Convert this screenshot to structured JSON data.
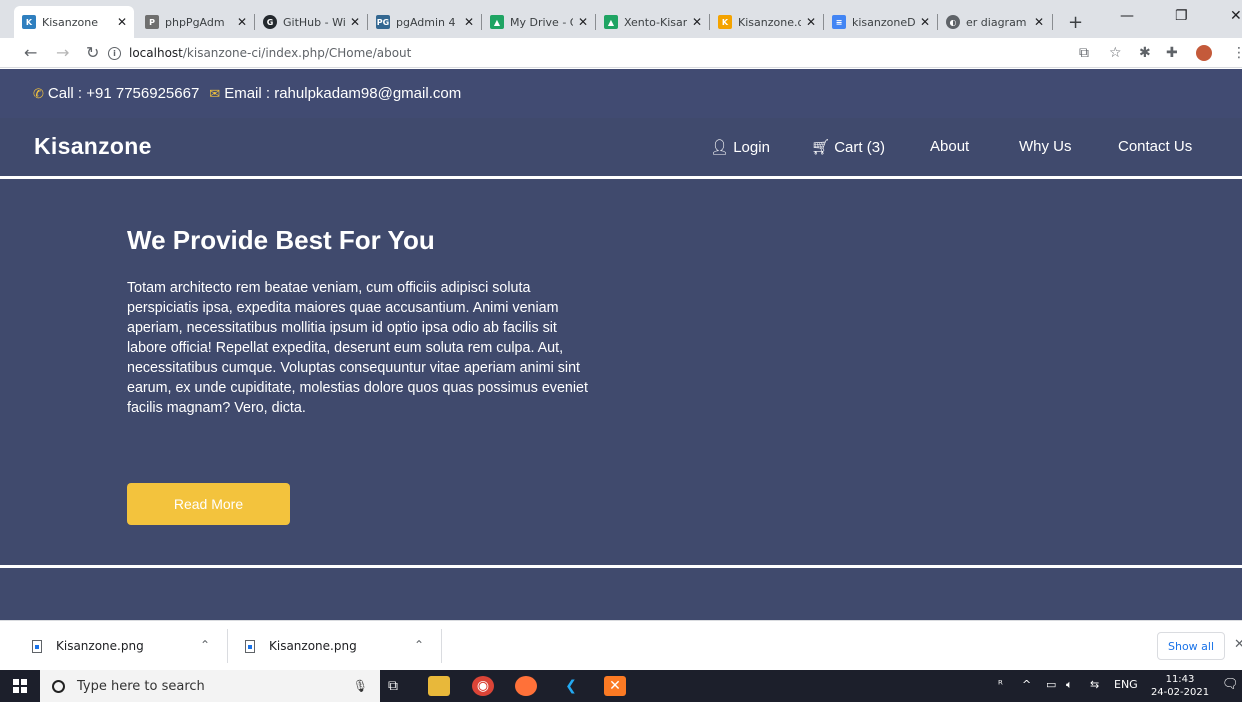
{
  "browser": {
    "tabs": [
      {
        "title": "Kisanzone",
        "color": "#2f7fbf",
        "glyph": "K",
        "active": true
      },
      {
        "title": "phpPgAdm",
        "color": "#6f6f6f",
        "glyph": "P",
        "active": false
      },
      {
        "title": "GitHub - Wi",
        "color": "#24292e",
        "glyph": "G",
        "active": false
      },
      {
        "title": "pgAdmin 4",
        "color": "#336791",
        "glyph": "PG",
        "active": false
      },
      {
        "title": "My Drive - G",
        "color": "#1fa463",
        "glyph": "▲",
        "active": false
      },
      {
        "title": "Xento-Kisan",
        "color": "#1fa463",
        "glyph": "▲",
        "active": false
      },
      {
        "title": "Kisanzone.d",
        "color": "#f4a300",
        "glyph": "K",
        "active": false
      },
      {
        "title": "kisanzoneDB",
        "color": "#4285f4",
        "glyph": "≡",
        "active": false
      },
      {
        "title": "er diagram",
        "color": "#5f6368",
        "glyph": "◐",
        "active": false
      }
    ],
    "url_host": "localhost",
    "url_path": "/kisanzone-ci/index.php/CHome/about"
  },
  "site": {
    "phone": "Call : +91 7756925667",
    "email": "Email : rahulpkadam98@gmail.com",
    "brand": "Kisanzone",
    "nav": {
      "login": "Login",
      "cart": "Cart (3)",
      "about": "About",
      "why_us": "Why Us",
      "contact": "Contact Us"
    },
    "hero": {
      "title": "We Provide Best For You",
      "text": "Totam architecto rem beatae veniam, cum officiis adipisci soluta perspiciatis ipsa, expedita maiores quae accusantium. Animi veniam aperiam, necessitatibus mollitia ipsum id optio ipsa odio ab facilis sit labore officia! Repellat expedita, deserunt eum soluta rem culpa. Aut, necessitatibus cumque. Voluptas consequuntur vitae aperiam animi sint earum, ex unde cupiditate, molestias dolore quos quas possimus eveniet facilis magnam? Vero, dicta.",
      "button": "Read More"
    },
    "colors": {
      "background": "#404a6d",
      "accent": "#f3c33d"
    }
  },
  "downloads": {
    "items": [
      "Kisanzone.png",
      "Kisanzone.png"
    ],
    "show_all": "Show all"
  },
  "taskbar": {
    "search_placeholder": "Type here to search",
    "lang": "ENG",
    "time": "11:43",
    "date": "24-02-2021"
  }
}
